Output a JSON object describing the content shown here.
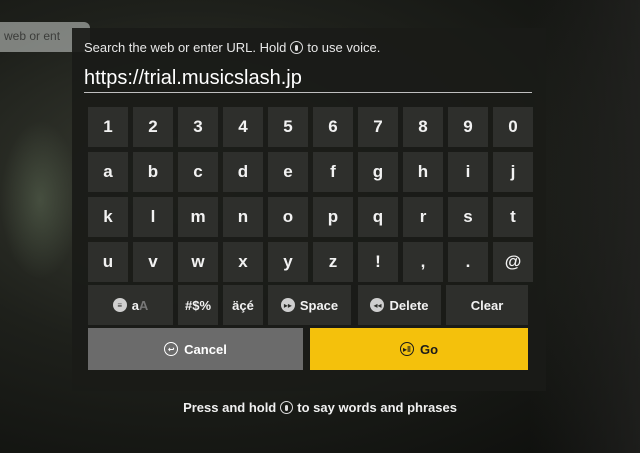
{
  "background": {
    "partial_text": "web or ent"
  },
  "prompt": {
    "before": "Search the web or enter URL. Hold",
    "after": "to use voice."
  },
  "url": {
    "value": "https://trial.musicslash.jp"
  },
  "keyboard": {
    "rows": [
      [
        "1",
        "2",
        "3",
        "4",
        "5",
        "6",
        "7",
        "8",
        "9",
        "0"
      ],
      [
        "a",
        "b",
        "c",
        "d",
        "e",
        "f",
        "g",
        "h",
        "i",
        "j"
      ],
      [
        "k",
        "l",
        "m",
        "n",
        "o",
        "p",
        "q",
        "r",
        "s",
        "t"
      ],
      [
        "u",
        "v",
        "w",
        "x",
        "y",
        "z",
        "!",
        ",",
        ".",
        "@"
      ]
    ],
    "function_keys": {
      "case_a": "a",
      "case_A": "A",
      "symbols": "#$%",
      "accents": "äçé",
      "space": "Space",
      "delete": "Delete",
      "clear": "Clear"
    }
  },
  "buttons": {
    "cancel": "Cancel",
    "go": "Go"
  },
  "hint": {
    "before": "Press and hold",
    "after": "to say words and phrases"
  },
  "colors": {
    "accent": "#f4c10c",
    "key_bg": "#2e2f2c",
    "cancel_bg": "#6b6b6b"
  },
  "icons": {
    "voice": "microphone-icon",
    "cancel": "back-arrow-icon",
    "go": "play-pause-icon",
    "space": "fast-forward-icon",
    "delete": "rewind-icon",
    "case": "menu-icon"
  }
}
